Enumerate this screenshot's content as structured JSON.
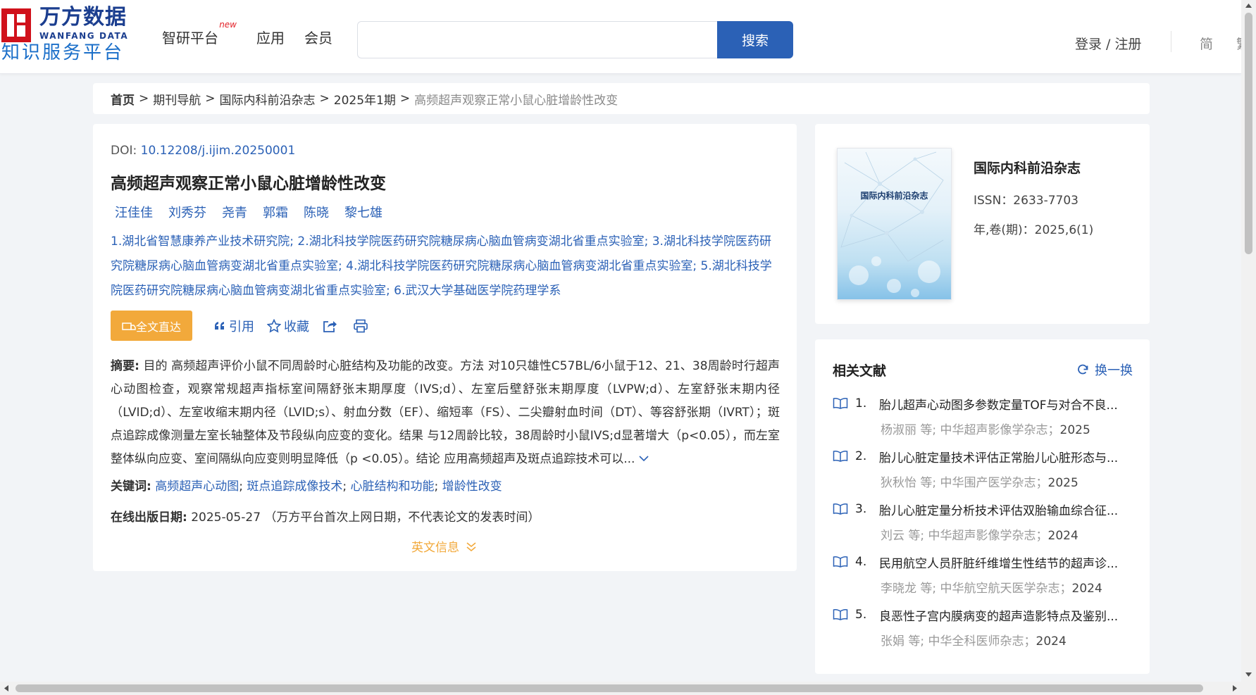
{
  "logo": {
    "cn": "万方数据",
    "en": "WANFANG DATA",
    "sub": "知识服务平台"
  },
  "nav": {
    "items": [
      "智研平台",
      "应用",
      "会员"
    ],
    "new_badge": "new"
  },
  "search": {
    "placeholder": "",
    "button": "搜索"
  },
  "header": {
    "login": "登录 / 注册",
    "lang_simplified": "简",
    "lang_traditional": "繁"
  },
  "breadcrumb": {
    "home": "首页",
    "sep": ">",
    "items": [
      "期刊导航",
      "国际内科前沿杂志",
      "2025年1期"
    ],
    "current": "高频超声观察正常小鼠心脏增龄性改变"
  },
  "article": {
    "doi_label": "DOI: ",
    "doi": "10.12208/j.ijim.20250001",
    "title": "高频超声观察正常小鼠心脏增龄性改变",
    "authors": [
      "汪佳佳",
      "刘秀芬",
      "尧青",
      "郭霜",
      "陈晓",
      "黎七雄"
    ],
    "affiliations": [
      "1.湖北省智慧康养产业技术研究院",
      "2.湖北科技学院医药研究院糖尿病心脑血管病变湖北省重点实验室",
      "3.湖北科技学院医药研究院糖尿病心脑血管病变湖北省重点实验室",
      "4.湖北科技学院医药研究院糖尿病心脑血管病变湖北省重点实验室",
      "5.湖北科技学院医药研究院糖尿病心脑血管病变湖北省重点实验室",
      "6.武汉大学基础医学院药理学系"
    ],
    "actions": {
      "fulltext": "全文直达",
      "cite": "引用",
      "favorite": "收藏"
    },
    "abstract_label": "摘要:",
    "abstract": "目的 高频超声评价小鼠不同周龄时心脏结构及功能的改变。方法 对10只雄性C57BL/6小鼠于12、21、38周龄时行超声心动图检查，观察常规超声指标室间隔舒张末期厚度（IVS;d）、左室后壁舒张末期厚度（LVPW;d）、左室舒张末期内径（LVID;d）、左室收缩末期内径（LVID;s）、射血分数（EF）、缩短率（FS）、二尖瓣射血时间（DT）、等容舒张期（IVRT）；斑点追踪成像测量左室长轴整体及节段纵向应变的变化。结果 与12周龄比较，38周龄时小鼠IVS;d显著增大（p<0.05），而左室整体纵向应变、室间隔纵向应变则明显降低（p <0.05）。结论 应用高频超声及斑点追踪技术可以...",
    "keywords_label": "关键词:",
    "keywords": [
      "高频超声心动图",
      "斑点追踪成像技术",
      "心脏结构和功能",
      "增龄性改变"
    ],
    "pubdate_label": "在线出版日期:",
    "pubdate": "2025-05-27",
    "pubdate_note": "（万方平台首次上网日期，不代表论文的发表时间）",
    "en_info": "英文信息"
  },
  "journal": {
    "cover_title": "国际内科前沿杂志",
    "name": "国际内科前沿杂志",
    "issn": "ISSN：2633-7703",
    "issue": "年,卷(期)：2025,6(1)"
  },
  "related": {
    "title": "相关文献",
    "swap": "换一换",
    "items": [
      {
        "num": "1.",
        "title": "胎儿超声心动图多参数定量TOF与对合不良...",
        "authors": "杨淑丽 等;",
        "journal": "中华超声影像学杂志；",
        "year": "2025"
      },
      {
        "num": "2.",
        "title": "胎儿心脏定量技术评估正常胎儿心脏形态与...",
        "authors": "狄秋怡 等;",
        "journal": "中华围产医学杂志；",
        "year": "2025"
      },
      {
        "num": "3.",
        "title": "胎儿心脏定量分析技术评估双胎输血综合征...",
        "authors": "刘云 等;",
        "journal": "中华超声影像学杂志；",
        "year": "2024"
      },
      {
        "num": "4.",
        "title": "民用航空人员肝脏纤维增生性结节的超声诊...",
        "authors": "李晓龙 等;",
        "journal": "中华航空航天医学杂志；",
        "year": "2024"
      },
      {
        "num": "5.",
        "title": "良恶性子宫内膜病变的超声造影特点及鉴别...",
        "authors": "张娟 等;",
        "journal": "中华全科医师杂志；",
        "year": "2024"
      }
    ]
  },
  "colors": {
    "brand_blue": "#2b61b6",
    "accent_orange": "#f2a93b",
    "logo_red": "#d0111b"
  }
}
